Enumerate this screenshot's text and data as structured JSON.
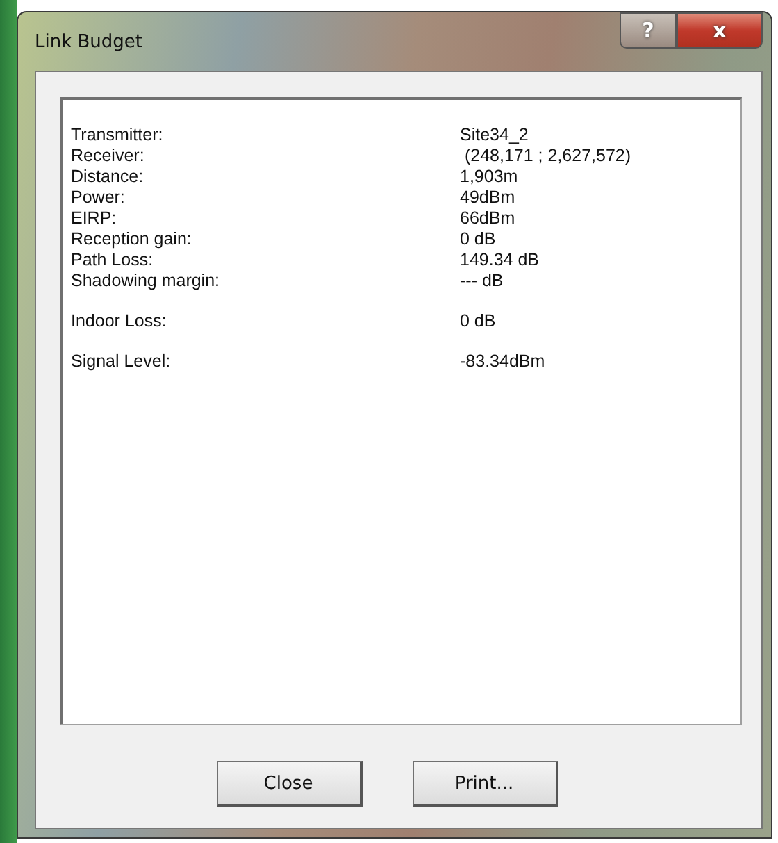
{
  "window": {
    "title": "Link Budget",
    "help_button": "?",
    "close_button": "x"
  },
  "groups": [
    {
      "rows": [
        {
          "label": "Transmitter:",
          "value": "Site34_2"
        },
        {
          "label": "Receiver:",
          "value": " (248,171 ; 2,627,572)"
        },
        {
          "label": "Distance:",
          "value": "1,903m"
        },
        {
          "label": "Power:",
          "value": "49dBm"
        },
        {
          "label": "EIRP:",
          "value": "66dBm"
        },
        {
          "label": "Reception gain:",
          "value": "0 dB"
        },
        {
          "label": "Path Loss:",
          "value": "149.34 dB"
        },
        {
          "label": "Shadowing margin:",
          "value": "--- dB"
        }
      ]
    },
    {
      "rows": [
        {
          "label": "Indoor Loss:",
          "value": "0 dB"
        }
      ]
    },
    {
      "rows": [
        {
          "label": "Signal Level:",
          "value": "-83.34dBm"
        }
      ]
    }
  ],
  "buttons": [
    "Close",
    "Print..."
  ]
}
